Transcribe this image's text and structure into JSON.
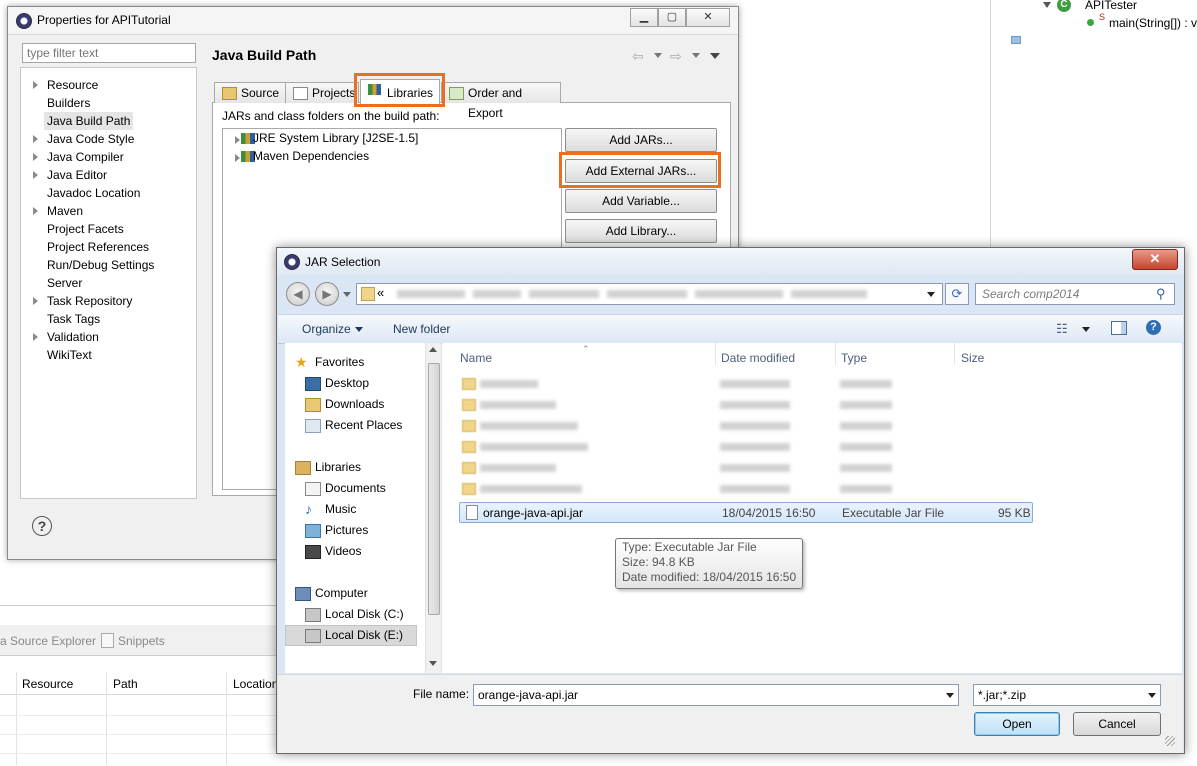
{
  "background": {
    "outline_class": "APITester",
    "outline_method": "main(String[]) : v",
    "bottom_tabs": [
      "a Source Explorer",
      "Snippets"
    ],
    "table_headers": [
      "Resource",
      "Path",
      "Location"
    ]
  },
  "properties": {
    "title": "Properties for APITutorial",
    "filter_placeholder": "type filter text",
    "nav_items": [
      {
        "label": "Resource",
        "arrow": true
      },
      {
        "label": "Builders",
        "arrow": false
      },
      {
        "label": "Java Build Path",
        "arrow": false,
        "selected": true
      },
      {
        "label": "Java Code Style",
        "arrow": true
      },
      {
        "label": "Java Compiler",
        "arrow": true
      },
      {
        "label": "Java Editor",
        "arrow": true
      },
      {
        "label": "Javadoc Location",
        "arrow": false
      },
      {
        "label": "Maven",
        "arrow": true
      },
      {
        "label": "Project Facets",
        "arrow": false
      },
      {
        "label": "Project References",
        "arrow": false
      },
      {
        "label": "Run/Debug Settings",
        "arrow": false
      },
      {
        "label": "Server",
        "arrow": false
      },
      {
        "label": "Task Repository",
        "arrow": true
      },
      {
        "label": "Task Tags",
        "arrow": false
      },
      {
        "label": "Validation",
        "arrow": true
      },
      {
        "label": "WikiText",
        "arrow": false
      }
    ],
    "page_title": "Java Build Path",
    "tabs": [
      "Source",
      "Projects",
      "Libraries",
      "Order and Export"
    ],
    "active_tab": "Libraries",
    "jars_label": "JARs and class folders on the build path:",
    "libraries": [
      "JRE System Library [J2SE-1.5]",
      "Maven Dependencies"
    ],
    "buttons": [
      "Add JARs...",
      "Add External JARs...",
      "Add Variable...",
      "Add Library..."
    ],
    "help_glyph": "?",
    "highlight_color": "#e8701f"
  },
  "jar_dialog": {
    "title": "JAR Selection",
    "address_prefix": "«",
    "search_placeholder": "Search comp2014",
    "organize_label": "Organize",
    "new_folder_label": "New folder",
    "left_pane": [
      {
        "label": "Favorites",
        "group": true,
        "icon": "star-icon"
      },
      {
        "label": "Desktop",
        "group": false,
        "icon": "desktop-icon"
      },
      {
        "label": "Downloads",
        "group": false,
        "icon": "downloads-icon"
      },
      {
        "label": "Recent Places",
        "group": false,
        "icon": "recent-places-icon"
      },
      {
        "label": "Libraries",
        "group": true,
        "icon": "libraries-icon"
      },
      {
        "label": "Documents",
        "group": false,
        "icon": "documents-icon"
      },
      {
        "label": "Music",
        "group": false,
        "icon": "music-icon"
      },
      {
        "label": "Pictures",
        "group": false,
        "icon": "pictures-icon"
      },
      {
        "label": "Videos",
        "group": false,
        "icon": "videos-icon"
      },
      {
        "label": "Computer",
        "group": true,
        "icon": "computer-icon"
      },
      {
        "label": "Local Disk (C:)",
        "group": false,
        "icon": "disk-icon"
      },
      {
        "label": "Local Disk (E:)",
        "group": false,
        "icon": "disk-icon",
        "selected": true
      }
    ],
    "columns": [
      "Name",
      "Date modified",
      "Type",
      "Size"
    ],
    "selected_file": {
      "name": "orange-java-api.jar",
      "date": "18/04/2015 16:50",
      "type": "Executable Jar File",
      "size": "95 KB"
    },
    "tooltip": [
      "Type: Executable Jar File",
      "Size: 94.8 KB",
      "Date modified: 18/04/2015 16:50"
    ],
    "file_name_label": "File name:",
    "file_name_value": "orange-java-api.jar",
    "filter_value": "*.jar;*.zip",
    "open_label": "Open",
    "cancel_label": "Cancel"
  }
}
